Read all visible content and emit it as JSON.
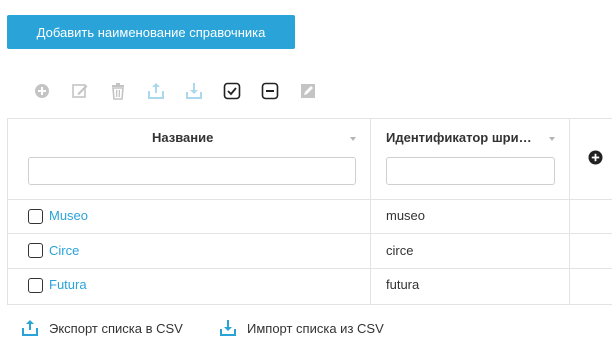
{
  "header": {
    "add_button_label": "Добавить наименование справочника"
  },
  "toolbar": {
    "icons": [
      {
        "name": "add-circle-icon",
        "enabled": false
      },
      {
        "name": "edit-icon",
        "enabled": false
      },
      {
        "name": "delete-icon",
        "enabled": false
      },
      {
        "name": "export-icon",
        "enabled": false
      },
      {
        "name": "import-icon",
        "enabled": false
      },
      {
        "name": "select-all-icon",
        "enabled": true
      },
      {
        "name": "deselect-all-icon",
        "enabled": true
      },
      {
        "name": "edit-box-icon",
        "enabled": false
      }
    ]
  },
  "table": {
    "columns": [
      {
        "label": "Название"
      },
      {
        "label": "Идентификатор шрифта"
      }
    ],
    "rows": [
      {
        "name": "Museo",
        "id": "museo"
      },
      {
        "name": "Circe",
        "id": "circe"
      },
      {
        "name": "Futura",
        "id": "futura"
      }
    ]
  },
  "footer": {
    "export_label": "Экспорт списка в CSV",
    "import_label": "Импорт списка из CSV"
  },
  "colors": {
    "accent": "#2aa3d9",
    "icon_disabled": "#c4c4c4",
    "icon_light_blue": "#a9d8ef",
    "border": "#e3e3e3"
  }
}
